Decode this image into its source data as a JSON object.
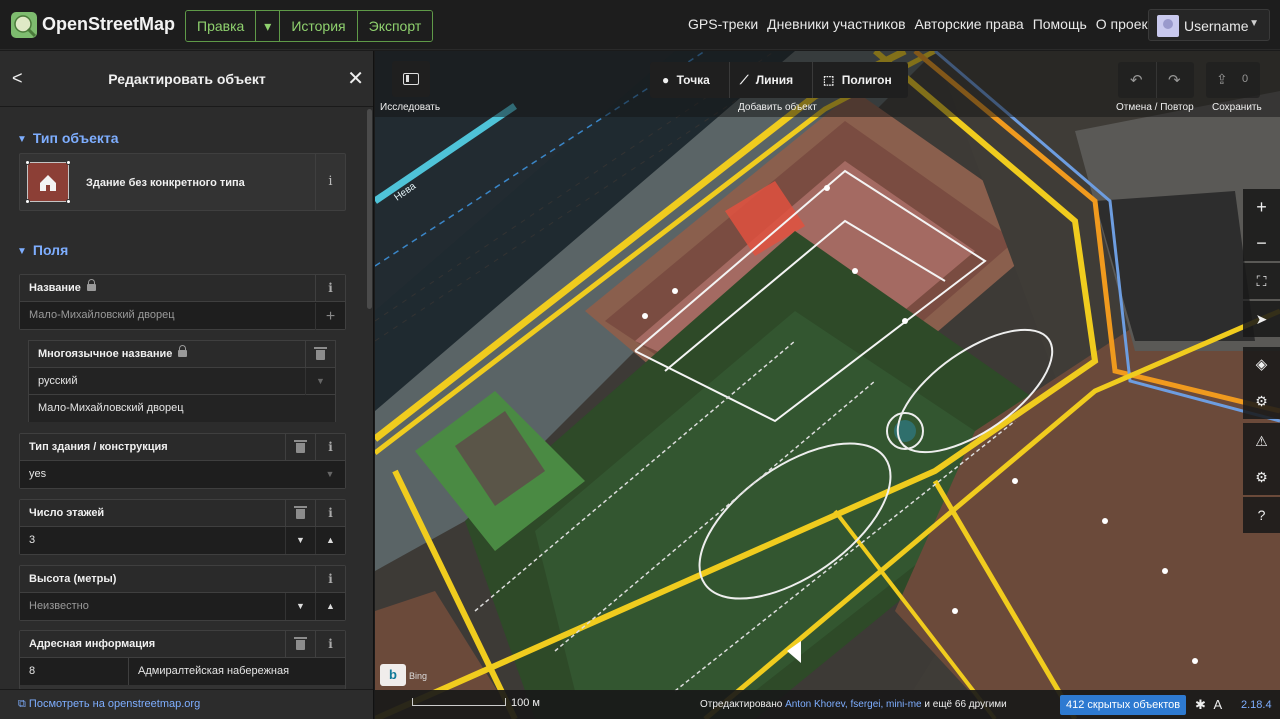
{
  "topbar": {
    "brand": "OpenStreetMap",
    "edit_label": "Правка",
    "history_label": "История",
    "export_label": "Экспорт",
    "links": [
      "GPS-треки",
      "Дневники участников",
      "Авторские права",
      "Помощь",
      "О проекте"
    ],
    "username": "Username"
  },
  "sidebar": {
    "title": "Редактировать объект",
    "preset_section": "Тип объекта",
    "preset_name": "Здание без конкретного типа",
    "fields_section": "Поля",
    "fields": {
      "name_label": "Название",
      "name_placeholder": "Мало-Михайловский дворец",
      "multilingual_label": "Многоязычное название",
      "language_value": "русский",
      "multilingual_value": "Мало-Михайловский дворец",
      "building_label": "Тип здания / конструкция",
      "building_value": "yes",
      "levels_label": "Число этажей",
      "levels_value": "3",
      "height_label": "Высота (метры)",
      "height_placeholder": "Неизвестно",
      "address_label": "Адресная информация",
      "address_housenumber": "8",
      "address_street": "Адмиралтейская набережная"
    },
    "footer_link": "Посмотреть на openstreetmap.org"
  },
  "map": {
    "explore_label": "Исследовать",
    "add_point": "Точка",
    "add_line": "Линия",
    "add_area": "Полигон",
    "add_label": "Добавить объект",
    "undo_redo_label": "Отмена / Повтор",
    "save_label": "Сохранить",
    "save_count": "0",
    "river_label": "Нева",
    "imagery_brand": "Bing",
    "scale": "100 м",
    "attribution_prefix": "Отредактировано",
    "attribution_users": "Anton Khorev, fsergei, mini-me",
    "attribution_suffix": "и ещё 66 другими",
    "hidden_features": "412 скрытых объектов",
    "version": "2.18.4"
  },
  "colors": {
    "accent_green": "#8fd16e",
    "link_blue": "#7eaeff",
    "badge_blue": "#2e7ad1",
    "building_selected": "#e0513f"
  }
}
